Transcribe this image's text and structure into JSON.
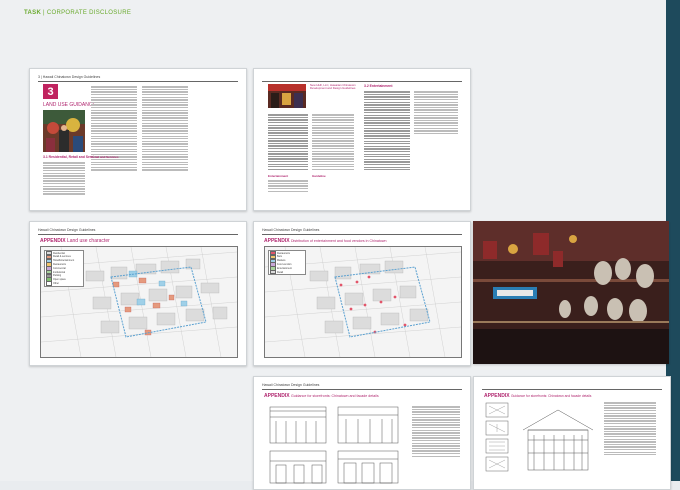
{
  "header": {
    "title_part1": "TASK",
    "separator": " | ",
    "title_part2": "CORPORATE DISCLOSURE"
  },
  "pages": {
    "p1": {
      "running_head": "3 | Hawaii Chinatown Design Guidelines",
      "chapter_number": "3",
      "chapter_title": "LAND USE GUIDANCE",
      "section_heading": "3.1 Residential, Retail and Services",
      "subheading": "Retail and Services"
    },
    "p2": {
      "intro_text": "New HHF, LLC, Hawaiian Chinatown Development and Design Guidelines",
      "section_heading": "3.2 Entertainment",
      "subheading_a": "Entertainment",
      "subheading_b": "Guideline"
    },
    "p3": {
      "running_head": "Hawaii Chinatown Design Guidelines",
      "appendix": "APPENDIX",
      "appendix_title": "Land use character",
      "legend_items": [
        "Residential",
        "Retail & services",
        "Hotel/Entertainment",
        "Restaurants",
        "Commercial",
        "Institutional",
        "Parking",
        "Open space",
        "Other"
      ]
    },
    "p4": {
      "running_head": "Hawaii Chinatown Design Guidelines",
      "appendix": "APPENDIX",
      "appendix_title": "Distribution of entertainment and food vendors in Chinatown",
      "legend_items": [
        "Restaurants",
        "Bars",
        "Markets",
        "Food vendors",
        "Entertainment",
        "Retail"
      ]
    },
    "p6": {
      "running_head": "Hawaii Chinatown Design Guidelines",
      "appendix": "APPENDIX",
      "appendix_title": "Guidance for storefronts: Chinatown and facade details"
    },
    "p7": {
      "appendix": "APPENDIX",
      "appendix_title": "Guidance for storefronts: Chinatown and facade details"
    }
  },
  "colors": {
    "accent_green": "#6aaa2e",
    "magenta": "#b0266f",
    "sidebar": "#1e4a5c"
  }
}
